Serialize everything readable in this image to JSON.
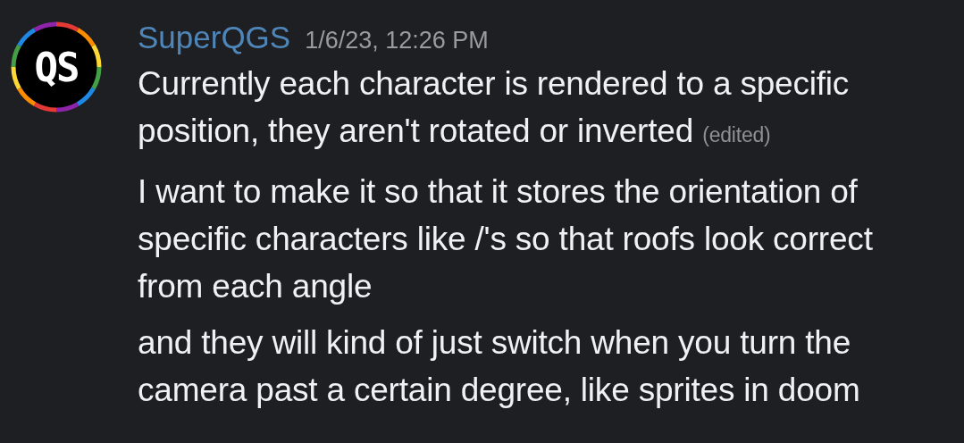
{
  "avatar": {
    "text": "QS"
  },
  "author": {
    "name": "SuperQGS",
    "timestamp": "1/6/23, 12:26 PM"
  },
  "messages": [
    {
      "text": "Currently each character is rendered to a specific position, they aren't rotated or inverted",
      "edited_label": "(edited)"
    },
    {
      "text": "I want to make it so that it stores the orientation of specific characters like /'s so that roofs look correct from each angle"
    },
    {
      "text": "and they will kind of just switch when you turn the camera past a certain degree, like sprites in doom"
    }
  ]
}
